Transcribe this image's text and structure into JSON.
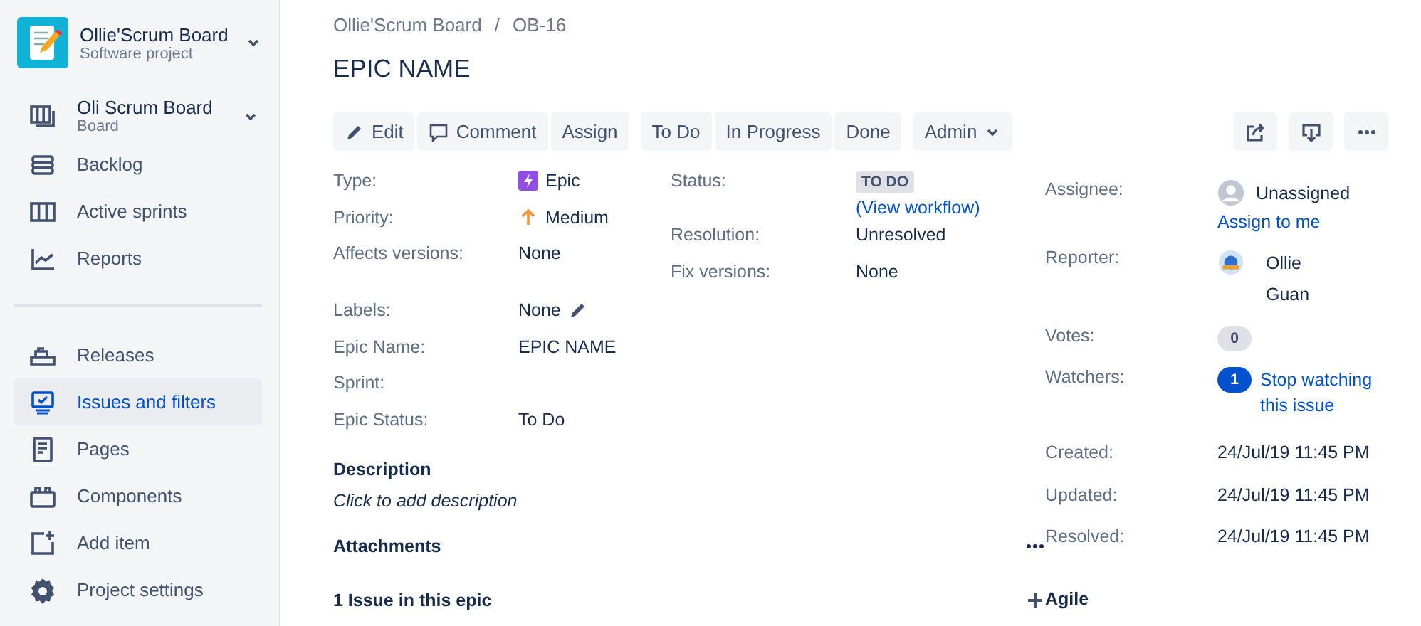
{
  "sidebar": {
    "project": {
      "name": "Ollie'Scrum Board",
      "type": "Software project"
    },
    "board": {
      "name": "Oli Scrum Board",
      "type": "Board"
    },
    "groups": [
      [
        {
          "label": "Backlog",
          "selected": false
        },
        {
          "label": "Active sprints",
          "selected": false
        },
        {
          "label": "Reports",
          "selected": false
        }
      ],
      [
        {
          "label": "Releases",
          "selected": false
        },
        {
          "label": "Issues and filters",
          "selected": true
        },
        {
          "label": "Pages",
          "selected": false
        },
        {
          "label": "Components",
          "selected": false
        },
        {
          "label": "Add item",
          "selected": false
        },
        {
          "label": "Project settings",
          "selected": false
        }
      ]
    ]
  },
  "breadcrumb": {
    "items": [
      "Ollie'Scrum Board",
      "OB-16"
    ],
    "separator": "/"
  },
  "issue_title": "EPIC NAME",
  "toolbar": [
    [
      {
        "label": "Edit",
        "kind": "edit"
      },
      {
        "label": "Comment",
        "kind": "comment"
      },
      {
        "label": "Assign",
        "kind": "plain"
      }
    ],
    [
      {
        "label": "To Do",
        "kind": "plain"
      },
      {
        "label": "In Progress",
        "kind": "plain"
      },
      {
        "label": "Done",
        "kind": "plain"
      }
    ],
    [
      {
        "label": "Admin",
        "kind": "dropdown"
      }
    ]
  ],
  "details": {
    "left": [
      {
        "label": "Type:",
        "value": "Epic",
        "kind": "type"
      },
      {
        "label": "Priority:",
        "value": "Medium",
        "kind": "priority"
      },
      {
        "label": "Affects versions:",
        "value": "None",
        "kind": "text"
      }
    ],
    "right": [
      {
        "label": "Status:",
        "value": "TO DO",
        "kind": "lozenge",
        "link": "(View workflow)"
      },
      {
        "label": "Resolution:",
        "value": "Unresolved",
        "kind": "text"
      },
      {
        "label": "Fix versions:",
        "value": "None",
        "kind": "text"
      }
    ]
  },
  "custom_fields": [
    {
      "label": "Labels:",
      "value": "None",
      "kind": "editable"
    },
    {
      "label": "Epic Name:",
      "value": "EPIC NAME",
      "kind": "text"
    },
    {
      "label": "Sprint:",
      "kind": "empty"
    },
    {
      "label": "Epic Status:",
      "value": "To Do",
      "kind": "text"
    }
  ],
  "sections": [
    {
      "title": "Description",
      "kind": "text",
      "text": "Click to add description"
    },
    {
      "title": "Attachments",
      "kind": "more"
    },
    {
      "title": "1 Issue in this epic",
      "kind": "add"
    }
  ],
  "people": [
    {
      "label": "Assignee:",
      "kind": "unassigned",
      "value": "Unassigned",
      "link": "Assign to me"
    },
    {
      "label": "Reporter:",
      "kind": "user",
      "value": "Ollie Guan"
    },
    {
      "label": "Votes:",
      "kind": "count",
      "value": "0"
    },
    {
      "label": "Watchers:",
      "kind": "watch",
      "value": "1",
      "link": "Stop watching this issue"
    }
  ],
  "dates": [
    {
      "label": "Created:",
      "value": "24/Jul/19 11:45 PM"
    },
    {
      "label": "Updated:",
      "value": "24/Jul/19 11:45 PM"
    },
    {
      "label": "Resolved:",
      "value": "24/Jul/19 11:45 PM"
    }
  ],
  "agile_title": "Agile"
}
